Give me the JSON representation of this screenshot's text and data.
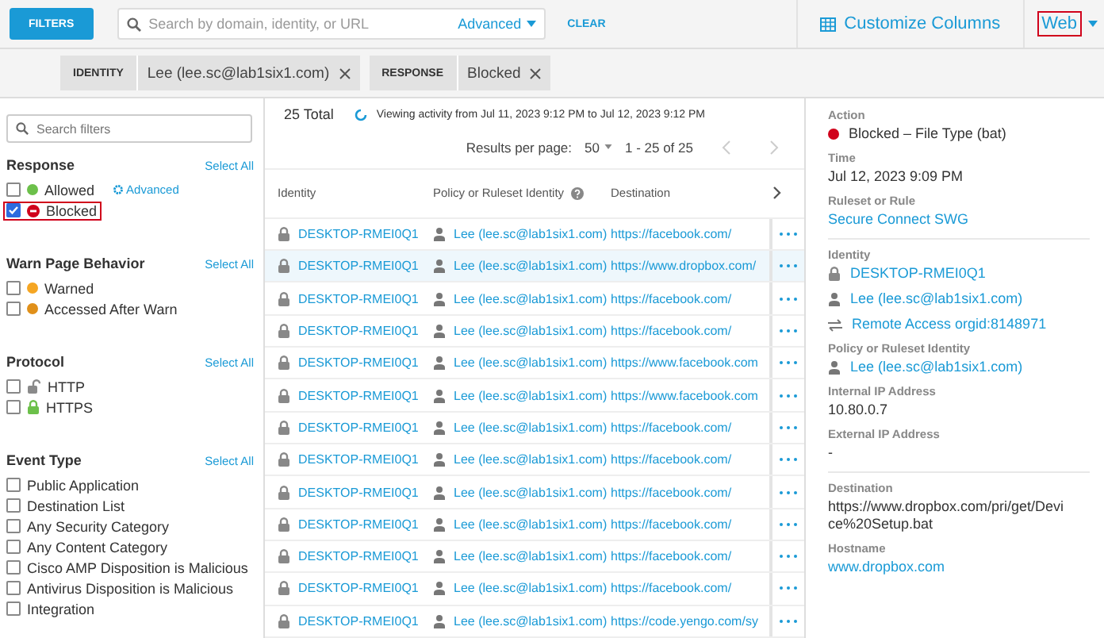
{
  "top_bar": {
    "filters_button": "FILTERS",
    "search": {
      "placeholder": "Search by domain, identity, or URL"
    },
    "advanced": "Advanced",
    "clear": "CLEAR",
    "customize": "Customize Columns",
    "view": {
      "label": "Web",
      "highlighted": true
    }
  },
  "chips": [
    {
      "label": "IDENTITY",
      "value": "Lee (lee.sc@lab1six1.com)"
    },
    {
      "label": "RESPONSE",
      "value": "Blocked"
    }
  ],
  "sidebar": {
    "search": {
      "placeholder": "Search filters"
    },
    "sections": [
      {
        "title": "Response",
        "select_all": "Select All",
        "options": [
          {
            "label": "Allowed",
            "checked": false,
            "highlighted": false,
            "kind": "dot",
            "color": "#6cc04a",
            "link": "Advanced"
          },
          {
            "label": "Blocked",
            "checked": true,
            "highlighted": true,
            "kind": "blocked",
            "color": "#d0021b"
          }
        ]
      },
      {
        "title": "Warn Page Behavior",
        "select_all": "Select All",
        "options": [
          {
            "label": "Warned",
            "checked": false,
            "highlighted": false,
            "kind": "dot",
            "color": "#f5a623"
          },
          {
            "label": "Accessed After Warn",
            "checked": false,
            "highlighted": false,
            "kind": "dot",
            "color": "#e0901a"
          }
        ]
      },
      {
        "title": "Protocol",
        "select_all": "Select All",
        "options": [
          {
            "label": "HTTP",
            "checked": false,
            "highlighted": false,
            "kind": "unlock",
            "color": "#8a8a8a"
          },
          {
            "label": "HTTPS",
            "checked": false,
            "highlighted": false,
            "kind": "lock",
            "color": "#6cc04a"
          }
        ]
      },
      {
        "title": "Event Type",
        "select_all": "Select All",
        "options": [
          {
            "label": "Public Application",
            "checked": false,
            "highlighted": false,
            "kind": "plain"
          },
          {
            "label": "Destination List",
            "checked": false,
            "highlighted": false,
            "kind": "plain"
          },
          {
            "label": "Any Security Category",
            "checked": false,
            "highlighted": false,
            "kind": "plain"
          },
          {
            "label": "Any Content Category",
            "checked": false,
            "highlighted": false,
            "kind": "plain"
          },
          {
            "label": "Cisco AMP Disposition is Malicious",
            "checked": false,
            "highlighted": false,
            "kind": "plain"
          },
          {
            "label": "Antivirus Disposition is Malicious",
            "checked": false,
            "highlighted": false,
            "kind": "plain"
          },
          {
            "label": "Integration",
            "checked": false,
            "highlighted": false,
            "kind": "plain"
          }
        ]
      }
    ]
  },
  "results": {
    "total": "25 Total",
    "viewing": "Viewing activity from Jul 11, 2023 9:12 PM to Jul 12, 2023 9:12 PM",
    "per_page_label": "Results per page:",
    "per_page": "50",
    "range": "1 - 25 of 25"
  },
  "table": {
    "columns": [
      "Identity",
      "Policy or Ruleset Identity",
      "Destination"
    ],
    "rows": [
      {
        "identity": "DESKTOP-RMEI0Q1",
        "policy": "Lee (lee.sc@lab1six1.com)",
        "destination": "https://facebook.com/",
        "selected": false
      },
      {
        "identity": "DESKTOP-RMEI0Q1",
        "policy": "Lee (lee.sc@lab1six1.com)",
        "destination": "https://www.dropbox.com/",
        "selected": true
      },
      {
        "identity": "DESKTOP-RMEI0Q1",
        "policy": "Lee (lee.sc@lab1six1.com)",
        "destination": "https://facebook.com/",
        "selected": false
      },
      {
        "identity": "DESKTOP-RMEI0Q1",
        "policy": "Lee (lee.sc@lab1six1.com)",
        "destination": "https://facebook.com/",
        "selected": false
      },
      {
        "identity": "DESKTOP-RMEI0Q1",
        "policy": "Lee (lee.sc@lab1six1.com)",
        "destination": "https://www.facebook.com",
        "selected": false
      },
      {
        "identity": "DESKTOP-RMEI0Q1",
        "policy": "Lee (lee.sc@lab1six1.com)",
        "destination": "https://www.facebook.com",
        "selected": false
      },
      {
        "identity": "DESKTOP-RMEI0Q1",
        "policy": "Lee (lee.sc@lab1six1.com)",
        "destination": "https://facebook.com/",
        "selected": false
      },
      {
        "identity": "DESKTOP-RMEI0Q1",
        "policy": "Lee (lee.sc@lab1six1.com)",
        "destination": "https://facebook.com/",
        "selected": false
      },
      {
        "identity": "DESKTOP-RMEI0Q1",
        "policy": "Lee (lee.sc@lab1six1.com)",
        "destination": "https://facebook.com/",
        "selected": false
      },
      {
        "identity": "DESKTOP-RMEI0Q1",
        "policy": "Lee (lee.sc@lab1six1.com)",
        "destination": "https://facebook.com/",
        "selected": false
      },
      {
        "identity": "DESKTOP-RMEI0Q1",
        "policy": "Lee (lee.sc@lab1six1.com)",
        "destination": "https://facebook.com/",
        "selected": false
      },
      {
        "identity": "DESKTOP-RMEI0Q1",
        "policy": "Lee (lee.sc@lab1six1.com)",
        "destination": "https://facebook.com/",
        "selected": false
      },
      {
        "identity": "DESKTOP-RMEI0Q1",
        "policy": "Lee (lee.sc@lab1six1.com)",
        "destination": "https://code.yengo.com/sy",
        "selected": false
      }
    ]
  },
  "detail": {
    "groups": [
      [
        {
          "label": "Action",
          "values": [
            {
              "text": "Blocked – File Type (bat)",
              "kind": "status",
              "color": "#d0021b"
            }
          ]
        },
        {
          "label": "Time",
          "values": [
            {
              "text": "Jul 12, 2023 9:09 PM",
              "kind": "plain"
            }
          ]
        },
        {
          "label": "Ruleset or Rule",
          "values": [
            {
              "text": "Secure Connect SWG",
              "kind": "link"
            }
          ]
        }
      ],
      [
        {
          "label": "Identity",
          "values": [
            {
              "text": "DESKTOP-RMEI0Q1",
              "kind": "device"
            },
            {
              "text": "Lee (lee.sc@lab1six1.com)",
              "kind": "user"
            },
            {
              "text": "Remote Access orgid:8148971",
              "kind": "tunnel"
            }
          ]
        },
        {
          "label": "Policy or Ruleset Identity",
          "values": [
            {
              "text": "Lee (lee.sc@lab1six1.com)",
              "kind": "user"
            }
          ]
        },
        {
          "label": "Internal IP Address",
          "values": [
            {
              "text": "10.80.0.7",
              "kind": "plain"
            }
          ]
        },
        {
          "label": "External IP Address",
          "values": [
            {
              "text": "-",
              "kind": "plain"
            }
          ]
        }
      ],
      [
        {
          "label": "Destination",
          "values": [
            {
              "text": "https://www.dropbox.com/pri/get/Device%20Setup.bat",
              "kind": "plain"
            }
          ]
        },
        {
          "label": "Hostname",
          "values": [
            {
              "text": "www.dropbox.com",
              "kind": "link"
            }
          ]
        }
      ]
    ]
  }
}
